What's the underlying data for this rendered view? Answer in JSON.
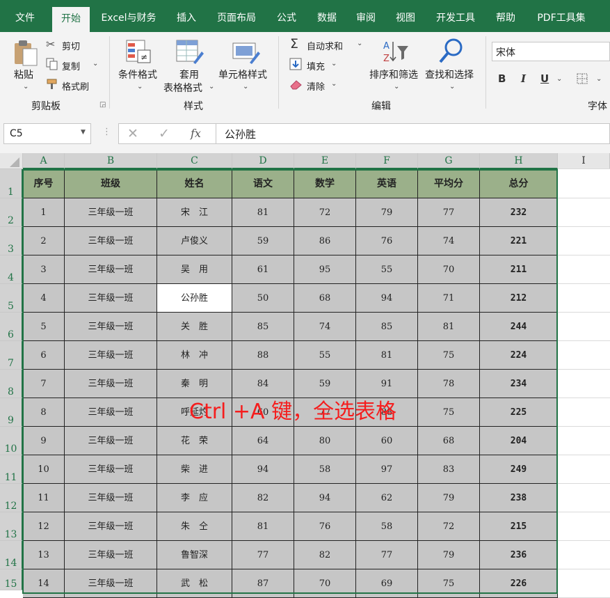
{
  "ribbon_tabs": [
    "文件",
    "开始",
    "Excel与财务",
    "插入",
    "页面布局",
    "公式",
    "数据",
    "审阅",
    "视图",
    "开发工具",
    "帮助",
    "PDF工具集"
  ],
  "active_tab": "开始",
  "clipboard": {
    "paste": "粘贴",
    "cut": "剪切",
    "copy": "复制",
    "format_painter": "格式刷",
    "group": "剪贴板"
  },
  "styles": {
    "conditional": "条件格式",
    "table_format_1": "套用",
    "table_format_2": "表格格式",
    "cell_styles": "单元格样式",
    "group": "样式"
  },
  "editing": {
    "autosum": "自动求和",
    "fill": "填充",
    "clear": "清除",
    "sort_filter": "排序和筛选",
    "find_select": "查找和选择",
    "group": "编辑"
  },
  "font": {
    "name": "宋体",
    "bold": "B",
    "italic": "I",
    "underline": "U",
    "group": "字体"
  },
  "formula_bar": {
    "name_box": "C5",
    "fx": "fx",
    "value": "公孙胜"
  },
  "columns": [
    "A",
    "B",
    "C",
    "D",
    "E",
    "F",
    "G",
    "H",
    "I"
  ],
  "rows": [
    "1",
    "2",
    "3",
    "4",
    "5",
    "6",
    "7",
    "8",
    "9",
    "10",
    "11",
    "12",
    "13",
    "14",
    "15"
  ],
  "selected_cell": "C5",
  "table": {
    "headers": [
      "序号",
      "班级",
      "姓名",
      "语文",
      "数学",
      "英语",
      "平均分",
      "总分"
    ],
    "rows": [
      [
        "1",
        "三年级一班",
        "宋　江",
        "81",
        "72",
        "79",
        "77",
        "232"
      ],
      [
        "2",
        "三年级一班",
        "卢俊义",
        "59",
        "86",
        "76",
        "74",
        "221"
      ],
      [
        "3",
        "三年级一班",
        "吴　用",
        "61",
        "95",
        "55",
        "70",
        "211"
      ],
      [
        "4",
        "三年级一班",
        "公孙胜",
        "50",
        "68",
        "94",
        "71",
        "212"
      ],
      [
        "5",
        "三年级一班",
        "关　胜",
        "85",
        "74",
        "85",
        "81",
        "244"
      ],
      [
        "6",
        "三年级一班",
        "林　冲",
        "88",
        "55",
        "81",
        "75",
        "224"
      ],
      [
        "7",
        "三年级一班",
        "秦　明",
        "84",
        "59",
        "91",
        "78",
        "234"
      ],
      [
        "8",
        "三年级一班",
        "呼延灼",
        "60",
        "77",
        "88",
        "75",
        "225"
      ],
      [
        "9",
        "三年级一班",
        "花　荣",
        "64",
        "80",
        "60",
        "68",
        "204"
      ],
      [
        "10",
        "三年级一班",
        "柴　进",
        "94",
        "58",
        "97",
        "83",
        "249"
      ],
      [
        "11",
        "三年级一班",
        "李　应",
        "82",
        "94",
        "62",
        "79",
        "238"
      ],
      [
        "12",
        "三年级一班",
        "朱　仝",
        "81",
        "76",
        "58",
        "72",
        "215"
      ],
      [
        "13",
        "三年级一班",
        "鲁智深",
        "77",
        "82",
        "77",
        "79",
        "236"
      ],
      [
        "14",
        "三年级一班",
        "武　松",
        "87",
        "70",
        "69",
        "75",
        "226"
      ]
    ]
  },
  "overlay_text": "Ctrl +A 键，全选表格",
  "colors": {
    "accent": "#217346",
    "header_fill": "#9bb08a",
    "selection_fill": "#c6c6c6",
    "overlay": "#f51d1d"
  }
}
